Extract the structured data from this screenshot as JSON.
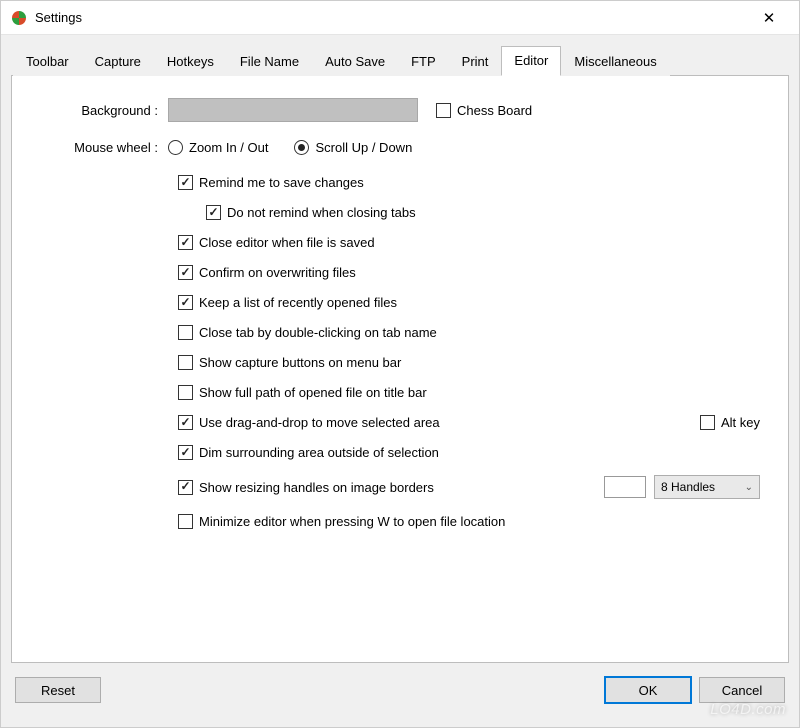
{
  "window": {
    "title": "Settings"
  },
  "tabs": [
    {
      "label": "Toolbar"
    },
    {
      "label": "Capture"
    },
    {
      "label": "Hotkeys"
    },
    {
      "label": "File Name"
    },
    {
      "label": "Auto Save"
    },
    {
      "label": "FTP"
    },
    {
      "label": "Print"
    },
    {
      "label": "Editor",
      "active": true
    },
    {
      "label": "Miscellaneous"
    }
  ],
  "editor": {
    "background_label": "Background :",
    "background_color": "#c0c0c0",
    "chess_board": {
      "label": "Chess Board",
      "checked": false
    },
    "mouse_wheel_label": "Mouse wheel :",
    "mouse_wheel": {
      "zoom": {
        "label": "Zoom In / Out",
        "checked": false
      },
      "scroll": {
        "label": "Scroll Up / Down",
        "checked": true
      }
    },
    "options": {
      "remind_save": {
        "label": "Remind me to save changes",
        "checked": true
      },
      "no_remind_tabs": {
        "label": "Do not remind when closing tabs",
        "checked": true
      },
      "close_on_save": {
        "label": "Close editor when file is saved",
        "checked": true
      },
      "confirm_overwrite": {
        "label": "Confirm on overwriting files",
        "checked": true
      },
      "keep_recent": {
        "label": "Keep a list of recently opened files",
        "checked": true
      },
      "close_tab_dbl": {
        "label": "Close tab by double-clicking on tab name",
        "checked": false
      },
      "show_capture_btns": {
        "label": "Show capture buttons on menu bar",
        "checked": false
      },
      "show_full_path": {
        "label": "Show full path of opened file on title bar",
        "checked": false
      },
      "drag_drop_move": {
        "label": "Use drag-and-drop to move selected area",
        "checked": true
      },
      "alt_key": {
        "label": "Alt key",
        "checked": false
      },
      "dim_surrounding": {
        "label": "Dim surrounding area outside of selection",
        "checked": true
      },
      "show_handles": {
        "label": "Show resizing handles on image borders",
        "checked": true
      },
      "handles_value": "",
      "handles_select": "8 Handles",
      "minimize_on_w": {
        "label": "Minimize editor when pressing W to open file location",
        "checked": false
      }
    }
  },
  "buttons": {
    "reset": "Reset",
    "ok": "OK",
    "cancel": "Cancel"
  },
  "watermark": "LO4D.com"
}
